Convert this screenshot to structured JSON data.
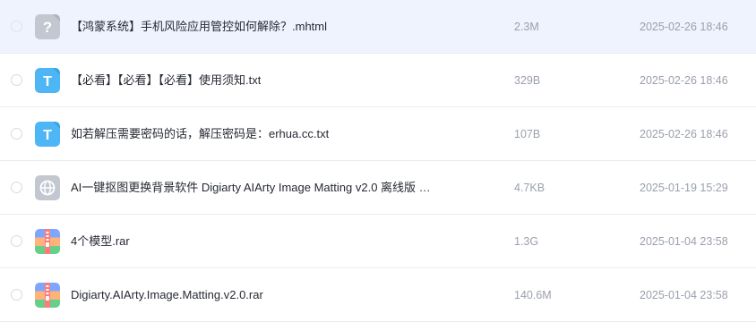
{
  "files": [
    {
      "icon": "unknown-file-icon",
      "name": "【鸿蒙系统】手机风险应用管控如何解除？.mhtml",
      "size": "2.3M",
      "date": "2025-02-26 18:46",
      "selected": true
    },
    {
      "icon": "text-file-icon",
      "name": "【必看】【必看】【必看】使用须知.txt",
      "size": "329B",
      "date": "2025-02-26 18:46",
      "selected": false
    },
    {
      "icon": "text-file-icon",
      "name": "如若解压需要密码的话，解压密码是：erhua.cc.txt",
      "size": "107B",
      "date": "2025-02-26 18:46",
      "selected": false
    },
    {
      "icon": "web-link-icon",
      "name": "AI一键抠图更换背景软件 Digiarty AIArty Image Matting v2.0 离线版 …",
      "size": "4.7KB",
      "date": "2025-01-19 15:29",
      "selected": false
    },
    {
      "icon": "archive-file-icon",
      "name": "4个模型.rar",
      "size": "1.3G",
      "date": "2025-01-04 23:58",
      "selected": false
    },
    {
      "icon": "archive-file-icon",
      "name": "Digiarty.AIArty.Image.Matting.v2.0.rar",
      "size": "140.6M",
      "date": "2025-01-04 23:58",
      "selected": false
    }
  ],
  "colors": {
    "selected_row": "#eef3fe",
    "text_icon": "#4fb6f5",
    "unknown_icon": "#c3c7cf",
    "web_icon": "#c3c7cf",
    "divider": "#e9ecf1"
  }
}
